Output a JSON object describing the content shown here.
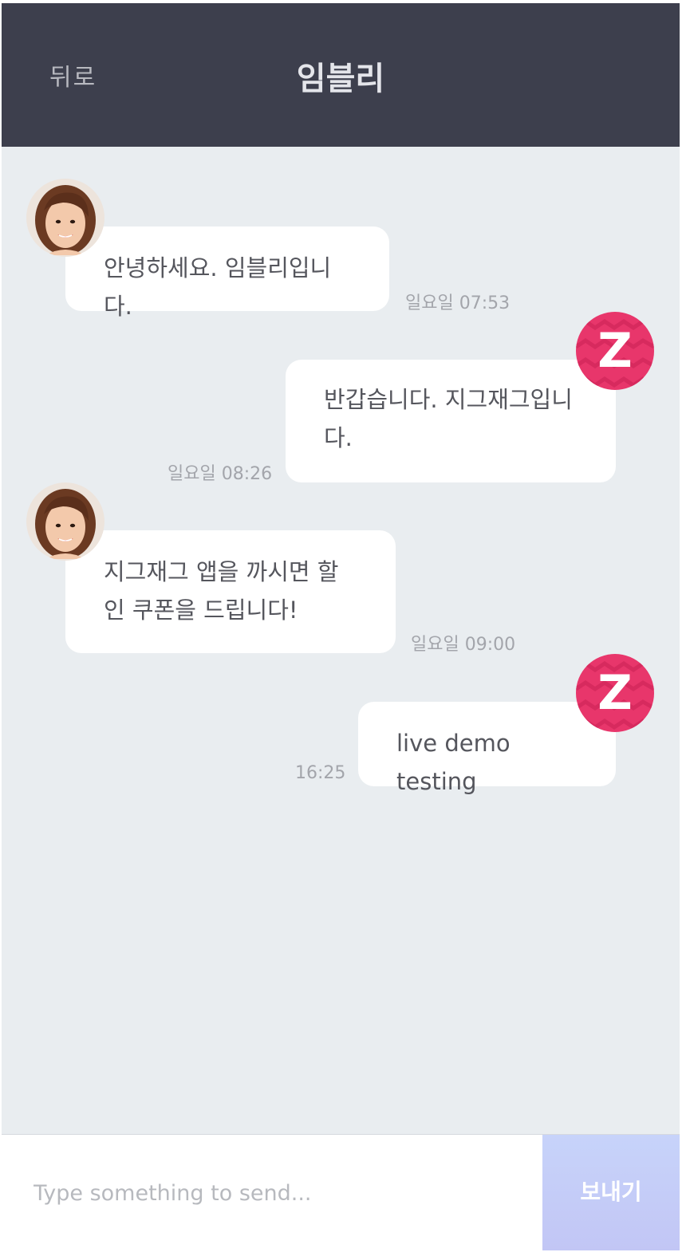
{
  "header": {
    "back_label": "뒤로",
    "title": "임블리"
  },
  "messages": [
    {
      "sender": "imvely",
      "text": "안녕하세요. 임블리입니다.",
      "time": "일요일 07:53"
    },
    {
      "sender": "zigzag",
      "text": "반갑습니다. 지그재그입니다.",
      "time": "일요일 08:26",
      "avatar_letter": "Z"
    },
    {
      "sender": "imvely",
      "text": "지그재그 앱을 까시면 할인 쿠폰을 드립니다!",
      "time": "일요일 09:00"
    },
    {
      "sender": "zigzag",
      "text": "live demo testing",
      "time": "16:25",
      "avatar_letter": "Z"
    }
  ],
  "composer": {
    "placeholder": "Type something to send...",
    "send_label": "보내기"
  },
  "colors": {
    "header_bg": "#3d3f4d",
    "chat_bg": "#e9edf0",
    "zigzag_brand": "#e8366b",
    "send_button": "#c5cdf8"
  }
}
